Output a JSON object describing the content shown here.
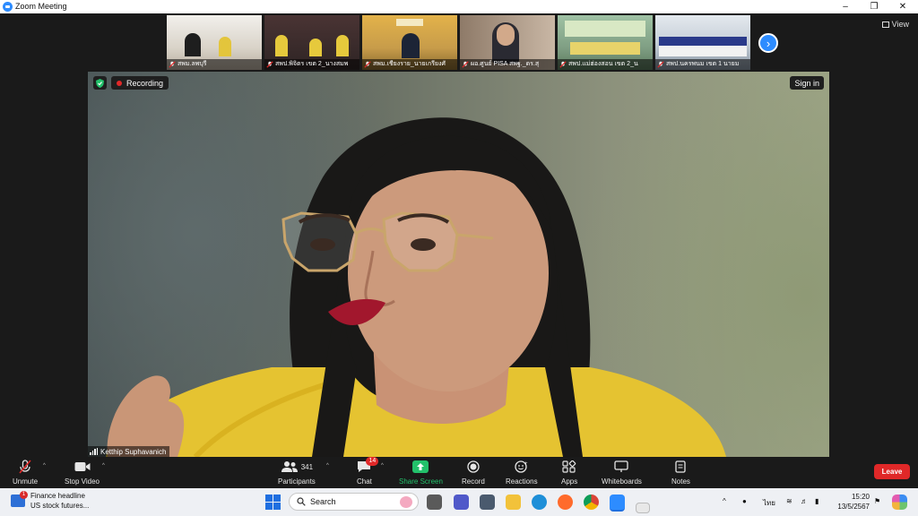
{
  "window": {
    "title": "Zoom Meeting",
    "controls": [
      "minimize",
      "restore",
      "close"
    ]
  },
  "gallery": {
    "thumbnails": [
      {
        "name": "สพม.ลพบุรี",
        "bg": "#d9d3c8"
      },
      {
        "name": "สพป.พิจิตร เขต 2_นางสมพ",
        "bg": "#3a2c2c"
      },
      {
        "name": "สพม.เชียงราย_นายเกรียงศั",
        "bg": "#c79c4a"
      },
      {
        "name": "ผอ.ศูนย์ PISA สพฐ._ดร.สุ",
        "bg": "#b9a593"
      },
      {
        "name": "สพป.แม่ฮ่องสอน เขต 2_น",
        "bg": "#7f9e83"
      },
      {
        "name": "สพป.นครพนม เขต 1 นายม",
        "bg": "#c6cfd8"
      }
    ],
    "view_label": "View"
  },
  "main_video": {
    "recording_label": "Recording",
    "sign_in_label": "Sign in",
    "speaker_name": "Ketthip Suphavanich"
  },
  "toolbar": {
    "unmute": "Unmute",
    "stop_video": "Stop Video",
    "participants": "Participants",
    "participants_count": "341",
    "chat": "Chat",
    "chat_badge": "14",
    "share_screen": "Share Screen",
    "record": "Record",
    "reactions": "Reactions",
    "apps": "Apps",
    "whiteboards": "Whiteboards",
    "notes": "Notes",
    "leave": "Leave"
  },
  "taskbar": {
    "news_title": "Finance headline",
    "news_sub": "US stock futures...",
    "news_badge": "1",
    "search_placeholder": "Search",
    "language": "ไทย",
    "time": "15:20",
    "date": "13/5/2567"
  },
  "colors": {
    "accent": "#2d8cff",
    "leave": "#e02828",
    "share": "#23c16b"
  }
}
